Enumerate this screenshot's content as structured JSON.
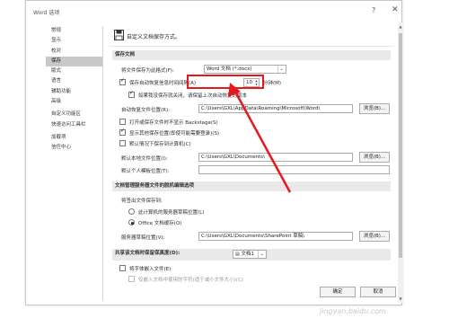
{
  "dialog": {
    "title": "Word 选项",
    "help_icon": "question-icon",
    "close_icon": "close-icon"
  },
  "sidebar": {
    "items": [
      {
        "label": "常规",
        "selected": false
      },
      {
        "label": "显示",
        "selected": false
      },
      {
        "label": "校对",
        "selected": false
      },
      {
        "label": "保存",
        "selected": true
      },
      {
        "label": "版式",
        "selected": false
      },
      {
        "label": "语言",
        "selected": false
      },
      {
        "label": "辅助功能",
        "selected": false
      },
      {
        "label": "高级",
        "selected": false
      },
      {
        "label": "自定义功能区",
        "selected": false
      },
      {
        "label": "快速访问工具栏",
        "selected": false
      },
      {
        "label": "加载项",
        "selected": false
      },
      {
        "label": "信任中心",
        "selected": false
      }
    ]
  },
  "main": {
    "header_text": "自定义文档保存方式。",
    "save_docs": {
      "section_title": "保存文档",
      "format_label": "将文件保存为此格式(F):",
      "format_value": "Word 文档 (*.docx)",
      "autorecover_label": "保存自动恢复信息时间间隔(A)",
      "autorecover_minutes": "10",
      "minutes_label": "分钟(M)",
      "keep_last_label": "如果我没保存就关闭，请保留上次自动恢复的版本",
      "autorecover_location_label": "自动恢复文件位置(R):",
      "autorecover_location_value": "C:\\Users\\GXL\\AppData\\Roaming\\Microsoft\\Word\\",
      "browse_label": "浏览(B)...",
      "no_backstage_label": "打开或保存文件时不显示 Backstage(S)",
      "show_additional_label": "显示其他保存位置(即使可能需要登录)(S)",
      "save_to_computer_label": "默认情况下保存到计算机(C)",
      "default_local_label": "默认本地文件位置(I):",
      "default_local_value": "C:\\Users\\GXL\\Documents\\",
      "browse_label_2": "浏览(B)...",
      "personal_templates_label": "默认个人模板位置(T):",
      "personal_templates_value": ""
    },
    "offline": {
      "section_title": "文档管理服务器文件的脱机编辑选项",
      "checked_out_label": "将签出文件保存到:",
      "option_server_label": "此计算机的服务器草稿位置(L)",
      "option_office_cache_label": "Office 文档缓存(O)",
      "drafts_label": "服务器草稿位置(V):",
      "drafts_value": "C:\\Users\\GXL\\Documents\\SharePoint 草稿\\",
      "browse_label_3": "浏览(B)..."
    },
    "fidelity": {
      "section_title": "共享该文档时保留保真度(D):",
      "document_value": "文档1",
      "embed_fonts_label": "将字体嵌入文件(E)",
      "embed_only_used_label": "仅嵌入文档中使用的字符(适于减小文件大小)(C)"
    },
    "footer": {
      "ok_label": "确定",
      "cancel_label": "取消"
    }
  },
  "watermark": "jingyan.baidu.com",
  "colors": {
    "highlight_red": "#e8171c",
    "selected_bg": "#c8c8c8",
    "section_bg": "#e9e9e9"
  }
}
